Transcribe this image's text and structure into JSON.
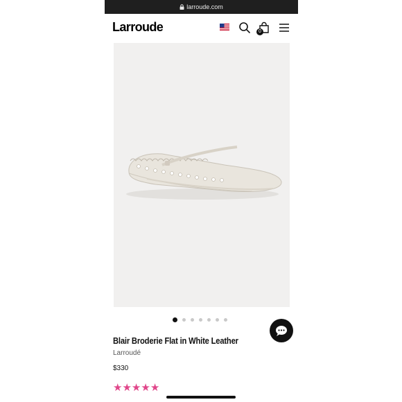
{
  "browser": {
    "url": "larroude.com"
  },
  "header": {
    "logo": "Larroude",
    "cart_count": "0",
    "icons": [
      "us-flag-icon",
      "search-icon",
      "shopping-bag-icon",
      "hamburger-menu-icon"
    ]
  },
  "product": {
    "image_alt": "White leather Mary Jane flat with scalloped broderie edge",
    "carousel": {
      "total": 7,
      "active": 1
    },
    "title": "Blair Broderie Flat in White Leather",
    "brand": "Larroudé",
    "price": "$330",
    "rating": 5
  },
  "colors": {
    "accent_star": "#e0468a",
    "hero_bg": "#f1f0ef",
    "topbar": "#1f1f1f"
  }
}
